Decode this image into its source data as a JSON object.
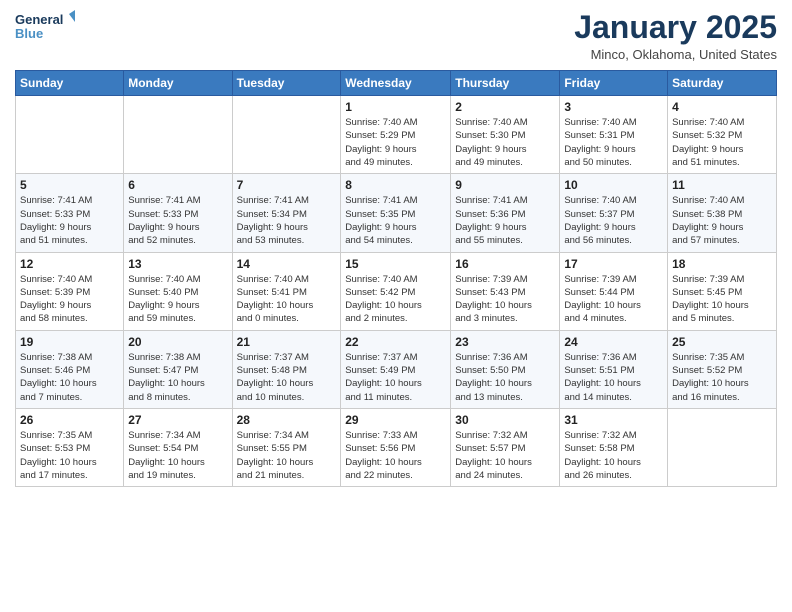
{
  "header": {
    "logo_line1": "General",
    "logo_line2": "Blue",
    "month": "January 2025",
    "location": "Minco, Oklahoma, United States"
  },
  "weekdays": [
    "Sunday",
    "Monday",
    "Tuesday",
    "Wednesday",
    "Thursday",
    "Friday",
    "Saturday"
  ],
  "weeks": [
    [
      {
        "day": "",
        "info": ""
      },
      {
        "day": "",
        "info": ""
      },
      {
        "day": "",
        "info": ""
      },
      {
        "day": "1",
        "info": "Sunrise: 7:40 AM\nSunset: 5:29 PM\nDaylight: 9 hours\nand 49 minutes."
      },
      {
        "day": "2",
        "info": "Sunrise: 7:40 AM\nSunset: 5:30 PM\nDaylight: 9 hours\nand 49 minutes."
      },
      {
        "day": "3",
        "info": "Sunrise: 7:40 AM\nSunset: 5:31 PM\nDaylight: 9 hours\nand 50 minutes."
      },
      {
        "day": "4",
        "info": "Sunrise: 7:40 AM\nSunset: 5:32 PM\nDaylight: 9 hours\nand 51 minutes."
      }
    ],
    [
      {
        "day": "5",
        "info": "Sunrise: 7:41 AM\nSunset: 5:33 PM\nDaylight: 9 hours\nand 51 minutes."
      },
      {
        "day": "6",
        "info": "Sunrise: 7:41 AM\nSunset: 5:33 PM\nDaylight: 9 hours\nand 52 minutes."
      },
      {
        "day": "7",
        "info": "Sunrise: 7:41 AM\nSunset: 5:34 PM\nDaylight: 9 hours\nand 53 minutes."
      },
      {
        "day": "8",
        "info": "Sunrise: 7:41 AM\nSunset: 5:35 PM\nDaylight: 9 hours\nand 54 minutes."
      },
      {
        "day": "9",
        "info": "Sunrise: 7:41 AM\nSunset: 5:36 PM\nDaylight: 9 hours\nand 55 minutes."
      },
      {
        "day": "10",
        "info": "Sunrise: 7:40 AM\nSunset: 5:37 PM\nDaylight: 9 hours\nand 56 minutes."
      },
      {
        "day": "11",
        "info": "Sunrise: 7:40 AM\nSunset: 5:38 PM\nDaylight: 9 hours\nand 57 minutes."
      }
    ],
    [
      {
        "day": "12",
        "info": "Sunrise: 7:40 AM\nSunset: 5:39 PM\nDaylight: 9 hours\nand 58 minutes."
      },
      {
        "day": "13",
        "info": "Sunrise: 7:40 AM\nSunset: 5:40 PM\nDaylight: 9 hours\nand 59 minutes."
      },
      {
        "day": "14",
        "info": "Sunrise: 7:40 AM\nSunset: 5:41 PM\nDaylight: 10 hours\nand 0 minutes."
      },
      {
        "day": "15",
        "info": "Sunrise: 7:40 AM\nSunset: 5:42 PM\nDaylight: 10 hours\nand 2 minutes."
      },
      {
        "day": "16",
        "info": "Sunrise: 7:39 AM\nSunset: 5:43 PM\nDaylight: 10 hours\nand 3 minutes."
      },
      {
        "day": "17",
        "info": "Sunrise: 7:39 AM\nSunset: 5:44 PM\nDaylight: 10 hours\nand 4 minutes."
      },
      {
        "day": "18",
        "info": "Sunrise: 7:39 AM\nSunset: 5:45 PM\nDaylight: 10 hours\nand 5 minutes."
      }
    ],
    [
      {
        "day": "19",
        "info": "Sunrise: 7:38 AM\nSunset: 5:46 PM\nDaylight: 10 hours\nand 7 minutes."
      },
      {
        "day": "20",
        "info": "Sunrise: 7:38 AM\nSunset: 5:47 PM\nDaylight: 10 hours\nand 8 minutes."
      },
      {
        "day": "21",
        "info": "Sunrise: 7:37 AM\nSunset: 5:48 PM\nDaylight: 10 hours\nand 10 minutes."
      },
      {
        "day": "22",
        "info": "Sunrise: 7:37 AM\nSunset: 5:49 PM\nDaylight: 10 hours\nand 11 minutes."
      },
      {
        "day": "23",
        "info": "Sunrise: 7:36 AM\nSunset: 5:50 PM\nDaylight: 10 hours\nand 13 minutes."
      },
      {
        "day": "24",
        "info": "Sunrise: 7:36 AM\nSunset: 5:51 PM\nDaylight: 10 hours\nand 14 minutes."
      },
      {
        "day": "25",
        "info": "Sunrise: 7:35 AM\nSunset: 5:52 PM\nDaylight: 10 hours\nand 16 minutes."
      }
    ],
    [
      {
        "day": "26",
        "info": "Sunrise: 7:35 AM\nSunset: 5:53 PM\nDaylight: 10 hours\nand 17 minutes."
      },
      {
        "day": "27",
        "info": "Sunrise: 7:34 AM\nSunset: 5:54 PM\nDaylight: 10 hours\nand 19 minutes."
      },
      {
        "day": "28",
        "info": "Sunrise: 7:34 AM\nSunset: 5:55 PM\nDaylight: 10 hours\nand 21 minutes."
      },
      {
        "day": "29",
        "info": "Sunrise: 7:33 AM\nSunset: 5:56 PM\nDaylight: 10 hours\nand 22 minutes."
      },
      {
        "day": "30",
        "info": "Sunrise: 7:32 AM\nSunset: 5:57 PM\nDaylight: 10 hours\nand 24 minutes."
      },
      {
        "day": "31",
        "info": "Sunrise: 7:32 AM\nSunset: 5:58 PM\nDaylight: 10 hours\nand 26 minutes."
      },
      {
        "day": "",
        "info": ""
      }
    ]
  ]
}
